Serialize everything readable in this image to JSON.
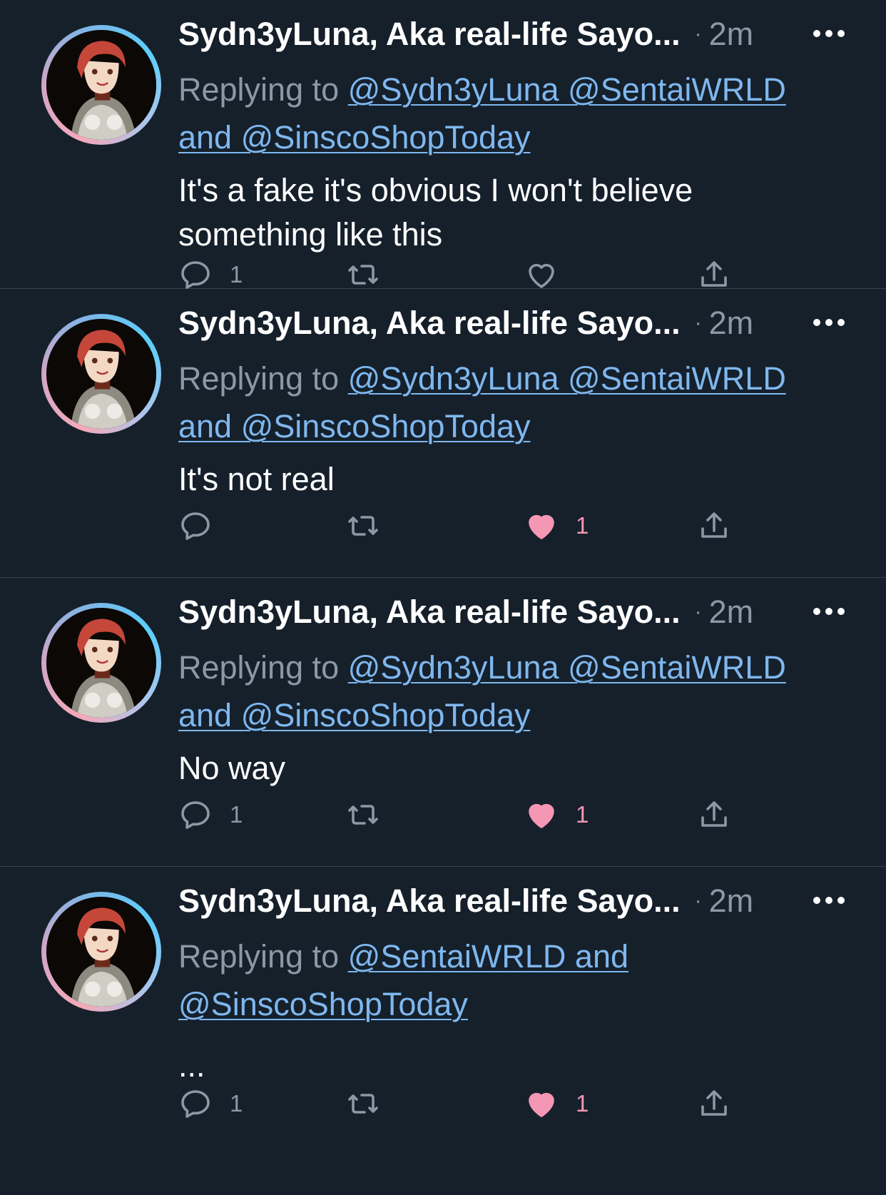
{
  "tweets": [
    {
      "name": "Sydn3yLuna, Aka real-life Sayo...",
      "separator": "·",
      "time": "2m",
      "replying_prefix": "Replying to",
      "replying_links": [
        "@Sydn3yLuna @SentaiWRLD",
        "and @SinscoShopToday"
      ],
      "text": "It's a fake it's obvious I won't believe something like this",
      "reply_count": "1",
      "retweet_count": "",
      "like_count": "",
      "liked": false
    },
    {
      "name": "Sydn3yLuna, Aka real-life Sayo...",
      "separator": "·",
      "time": "2m",
      "replying_prefix": "Replying to",
      "replying_links": [
        "@Sydn3yLuna @SentaiWRLD",
        "and @SinscoShopToday"
      ],
      "text": "It's not real",
      "reply_count": "",
      "retweet_count": "",
      "like_count": "1",
      "liked": true
    },
    {
      "name": "Sydn3yLuna, Aka real-life Sayo...",
      "separator": "·",
      "time": "2m",
      "replying_prefix": "Replying to",
      "replying_links": [
        "@Sydn3yLuna @SentaiWRLD",
        "and @SinscoShopToday"
      ],
      "text": "No way",
      "reply_count": "1",
      "retweet_count": "",
      "like_count": "1",
      "liked": true
    },
    {
      "name": "Sydn3yLuna, Aka real-life Sayo...",
      "separator": "·",
      "time": "2m",
      "replying_prefix": "Replying to",
      "replying_links": [
        "@SentaiWRLD and",
        "@SinscoShopToday"
      ],
      "text": "...",
      "reply_count": "1",
      "retweet_count": "",
      "like_count": "1",
      "liked": true
    }
  ],
  "colors": {
    "background": "#15202b",
    "divider": "#38444d",
    "link": "#7fb7ee",
    "muted": "#8b98a5",
    "like": "#f497b4"
  },
  "icons": {
    "reply": "reply-icon",
    "retweet": "retweet-icon",
    "like": "heart-icon",
    "share": "share-icon",
    "more": "more-icon"
  }
}
